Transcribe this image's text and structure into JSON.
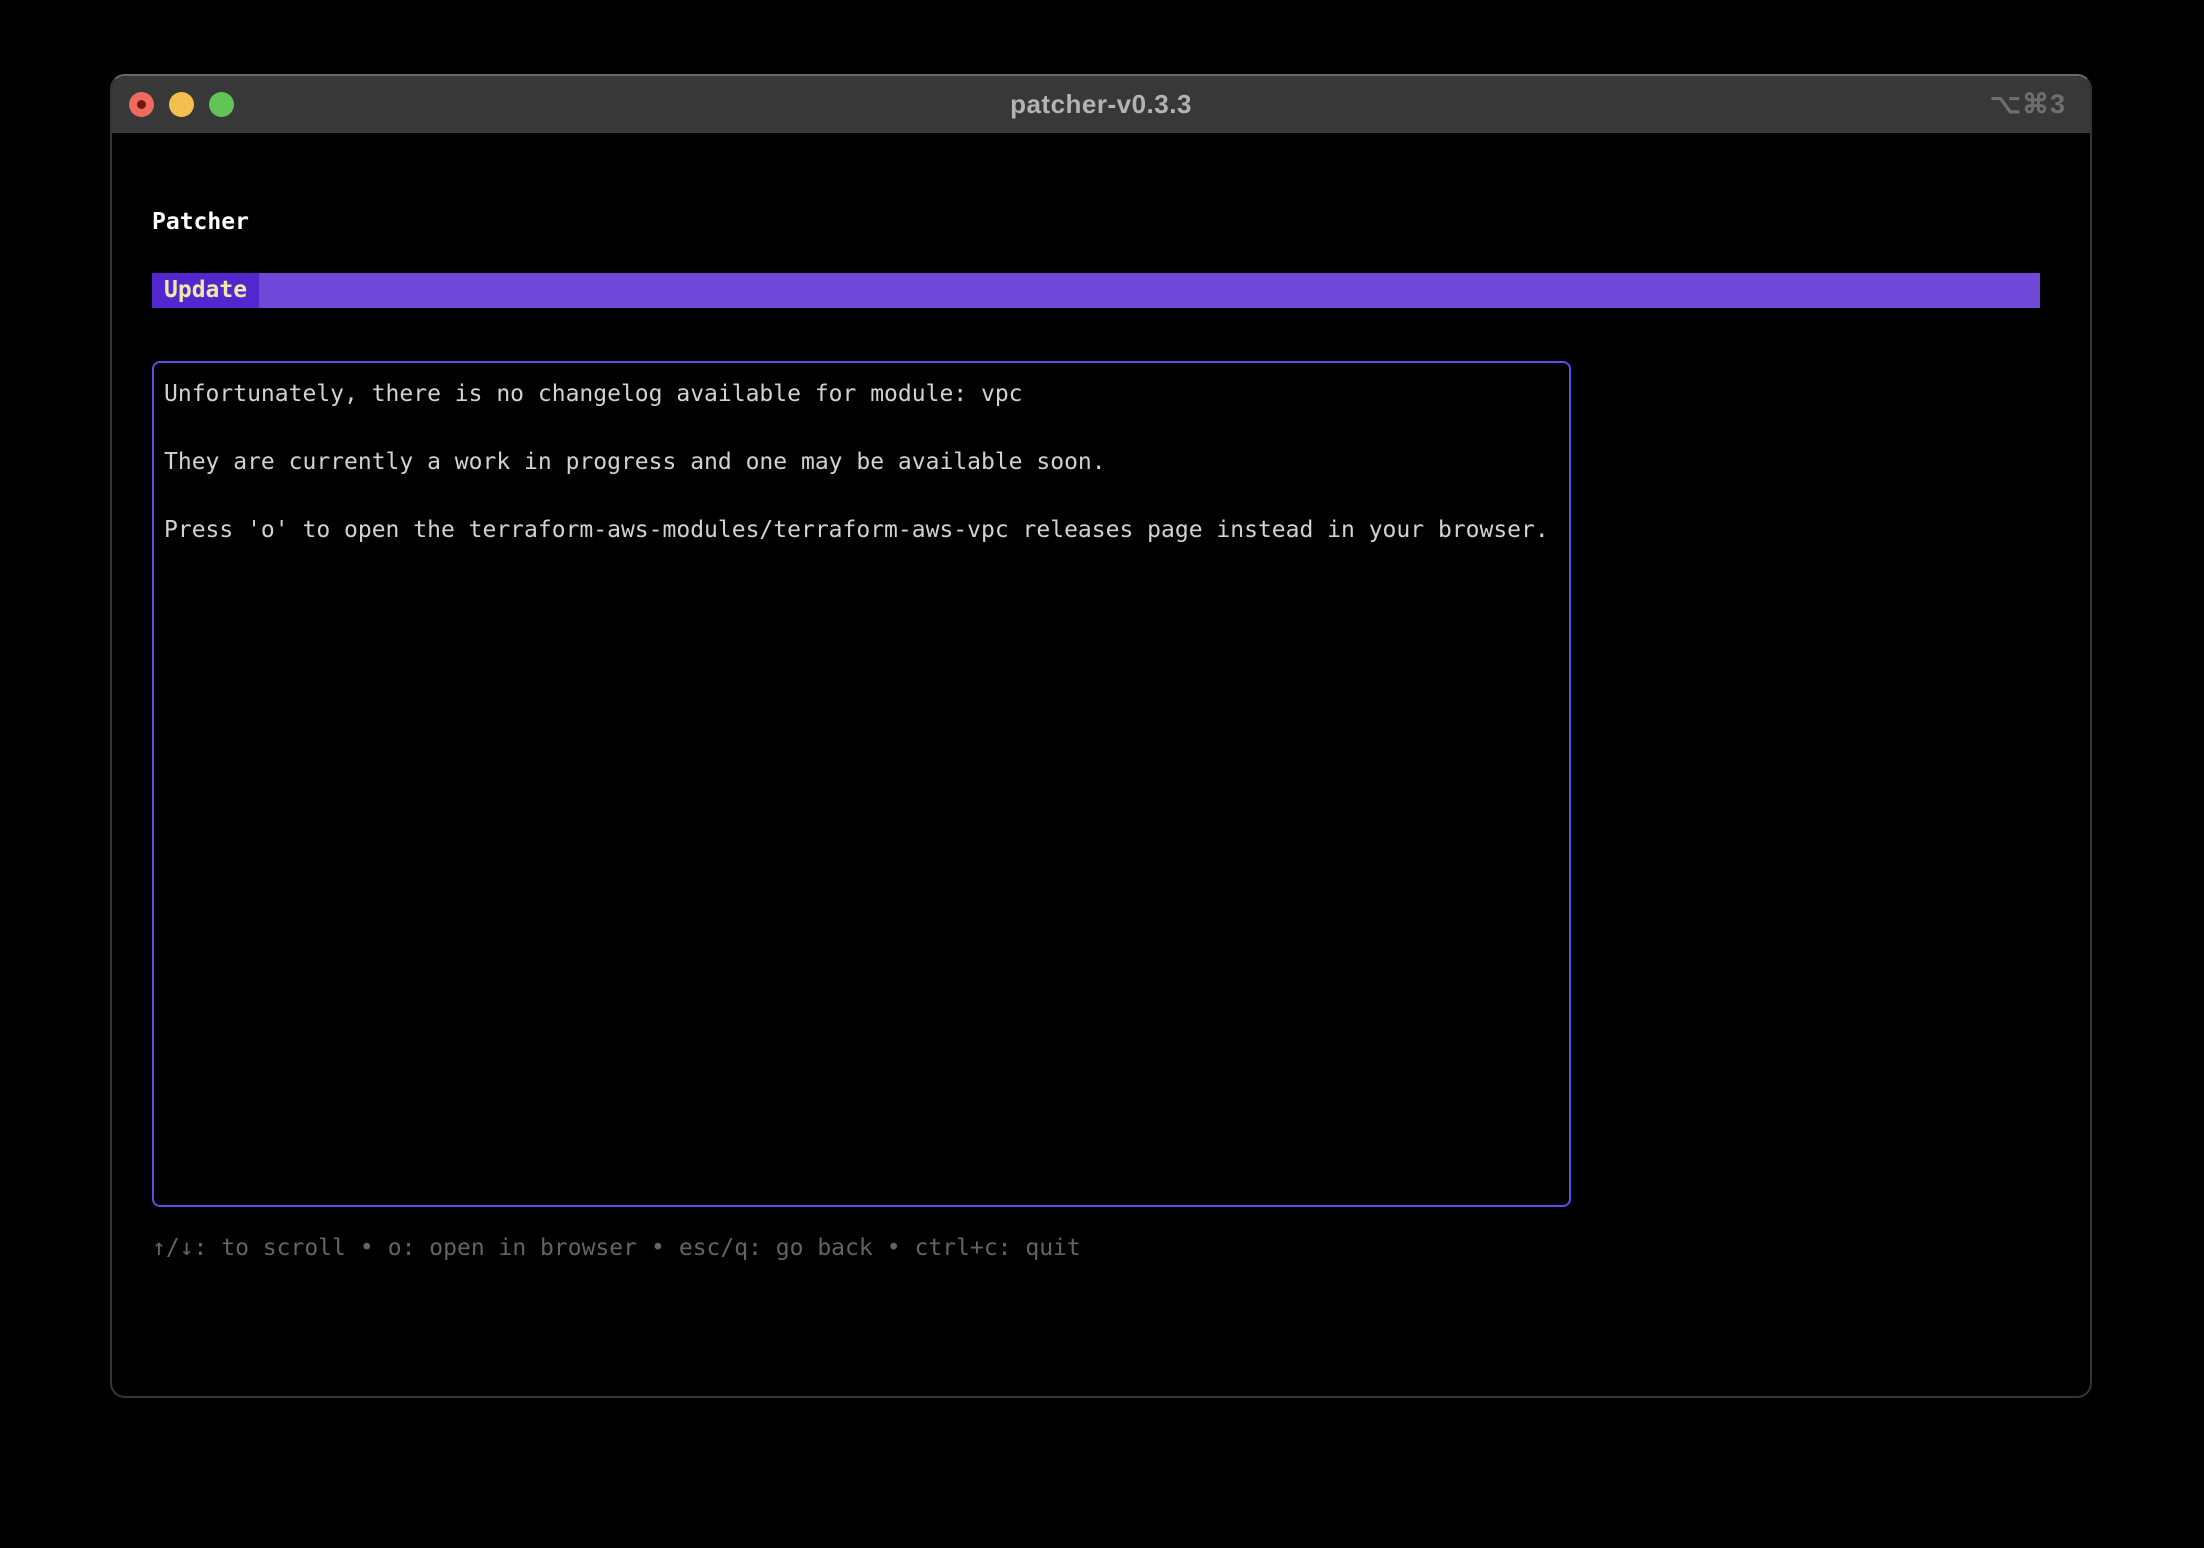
{
  "titlebar": {
    "title": "patcher-v0.3.3",
    "shortcut_hint": "⌥⌘3"
  },
  "app": {
    "heading": "Patcher",
    "active_tab": "Update"
  },
  "changelog": {
    "module": "vpc",
    "lines": [
      "Unfortunately, there is no changelog available for module: vpc",
      "They are currently a work in progress and one may be available soon.",
      "Press 'o' to open the terraform-aws-modules/terraform-aws-vpc releases page instead in your browser."
    ]
  },
  "help": {
    "separator": "•",
    "items": [
      "↑/↓: to scroll",
      "o: open in browser",
      "esc/q: go back",
      "ctrl+c: quit"
    ]
  },
  "colors": {
    "titlebar_bg": "#383838",
    "tab_active_bg": "#5227ce",
    "tab_bar_bg": "#6f48d7",
    "tab_text": "#eee8aa",
    "viewport_border": "#5952e1",
    "traffic_red": "#ee6a5e",
    "traffic_yellow": "#f5bf4f",
    "traffic_green": "#61c455"
  }
}
